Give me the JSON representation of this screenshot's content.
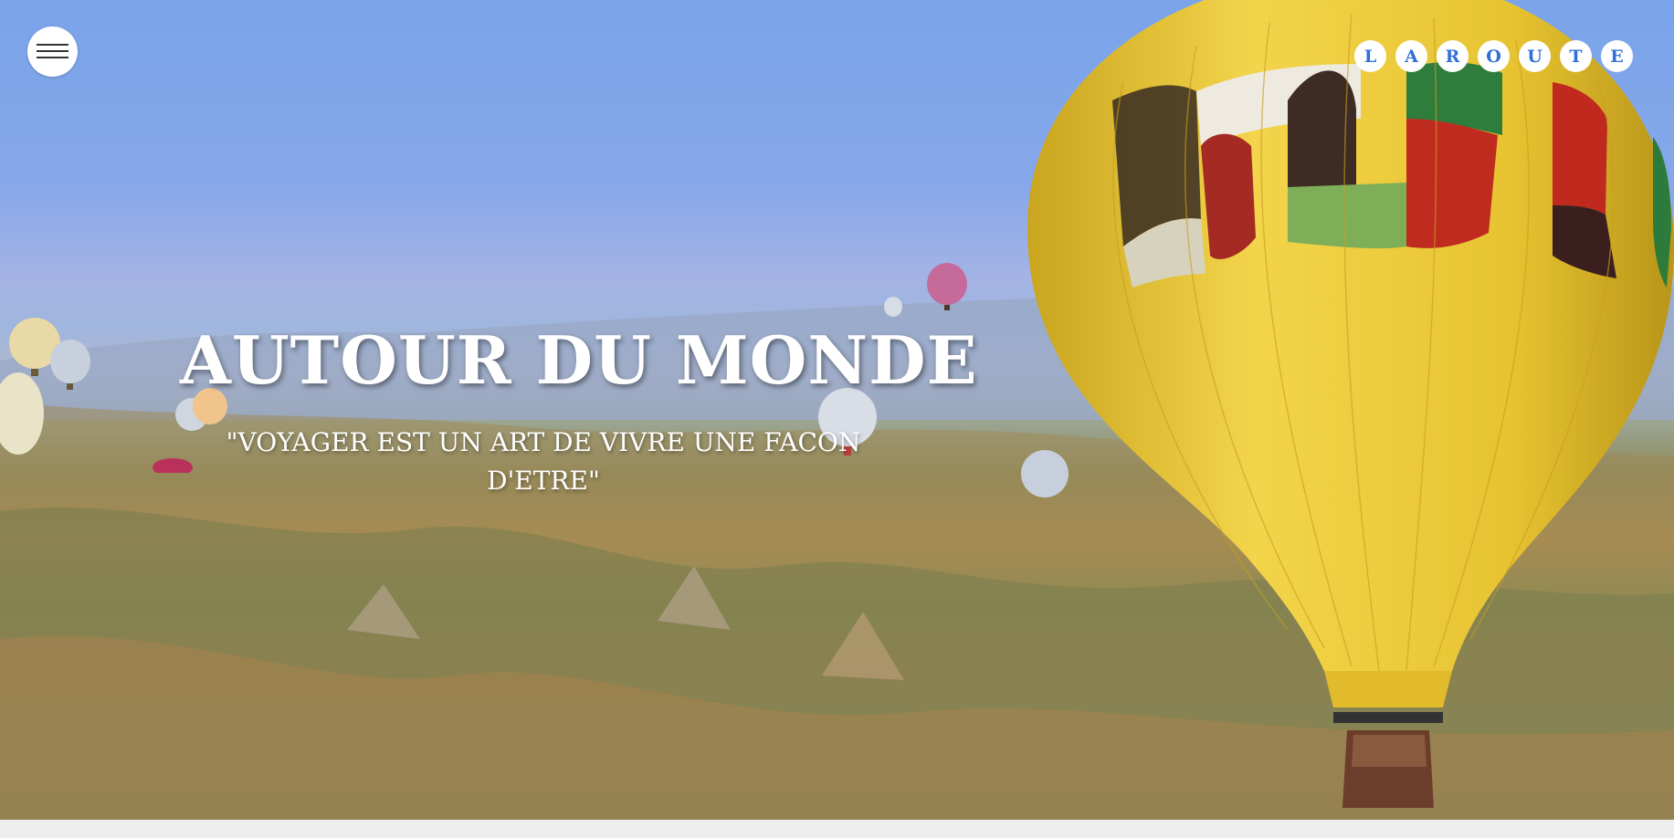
{
  "nav": {
    "menu_icon": "hamburger-menu-icon"
  },
  "logo": {
    "letters": [
      "L",
      "A",
      "R",
      "O",
      "U",
      "T",
      "E"
    ]
  },
  "hero": {
    "title": "AUTOUR DU MONDE",
    "subtitle": "\"VOYAGER EST UN ART DE VIVRE UNE FACON D'ETRE\"",
    "image_subject": "hot-air-balloons-over-landscape"
  },
  "colors": {
    "accent": "#2f6fd6",
    "balloon_yellow": "#e7c331",
    "sky": "#79a4ea"
  }
}
